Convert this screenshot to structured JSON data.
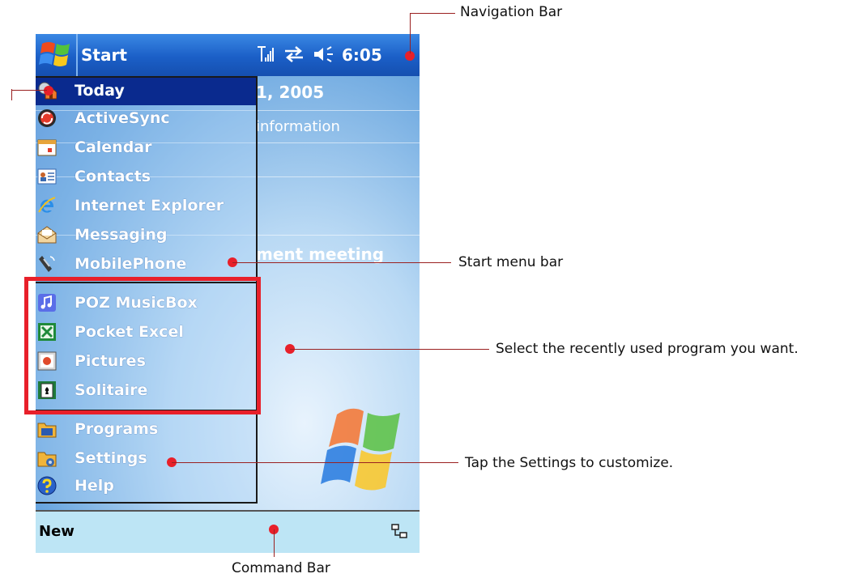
{
  "navbar": {
    "start_label": "Start",
    "clock": "6:05",
    "icons": [
      "windows-logo-icon",
      "signal-icon",
      "sync-icon",
      "speaker-icon"
    ]
  },
  "today": {
    "date": "1, 2005",
    "owner_info": "information",
    "appointment": "ment meeting"
  },
  "start_menu": {
    "items": [
      {
        "label": "Today",
        "icon": "today-icon",
        "selected": true
      },
      {
        "label": "ActiveSync",
        "icon": "activesync-icon"
      },
      {
        "label": "Calendar",
        "icon": "calendar-icon"
      },
      {
        "label": "Contacts",
        "icon": "contacts-icon"
      },
      {
        "label": "Internet Explorer",
        "icon": "internet-explorer-icon"
      },
      {
        "label": "Messaging",
        "icon": "messaging-icon"
      },
      {
        "label": "MobilePhone",
        "icon": "mobilephone-icon"
      }
    ],
    "recent": [
      {
        "label": "POZ MusicBox",
        "icon": "music-icon"
      },
      {
        "label": "Pocket Excel",
        "icon": "excel-icon"
      },
      {
        "label": "Pictures",
        "icon": "pictures-icon"
      },
      {
        "label": "Solitaire",
        "icon": "solitaire-icon"
      }
    ],
    "bottom": [
      {
        "label": "Programs",
        "icon": "programs-folder-icon"
      },
      {
        "label": "Settings",
        "icon": "settings-folder-icon"
      },
      {
        "label": "Help",
        "icon": "help-icon"
      }
    ]
  },
  "command_bar": {
    "new_label": "New",
    "icon": "network-icon"
  },
  "annotations": {
    "navigation_bar": "Navigation Bar",
    "start_menu_bar": "Start menu bar",
    "recent_programs": "Select the recently used program you want.",
    "settings_hint": "Tap the Settings to customize.",
    "command_bar": "Command Bar"
  },
  "colors": {
    "navbar": "#1b5fc7",
    "selected_item": "#0a2a8e",
    "command_bar": "#bde5f5",
    "callout_red": "#e8202a"
  }
}
